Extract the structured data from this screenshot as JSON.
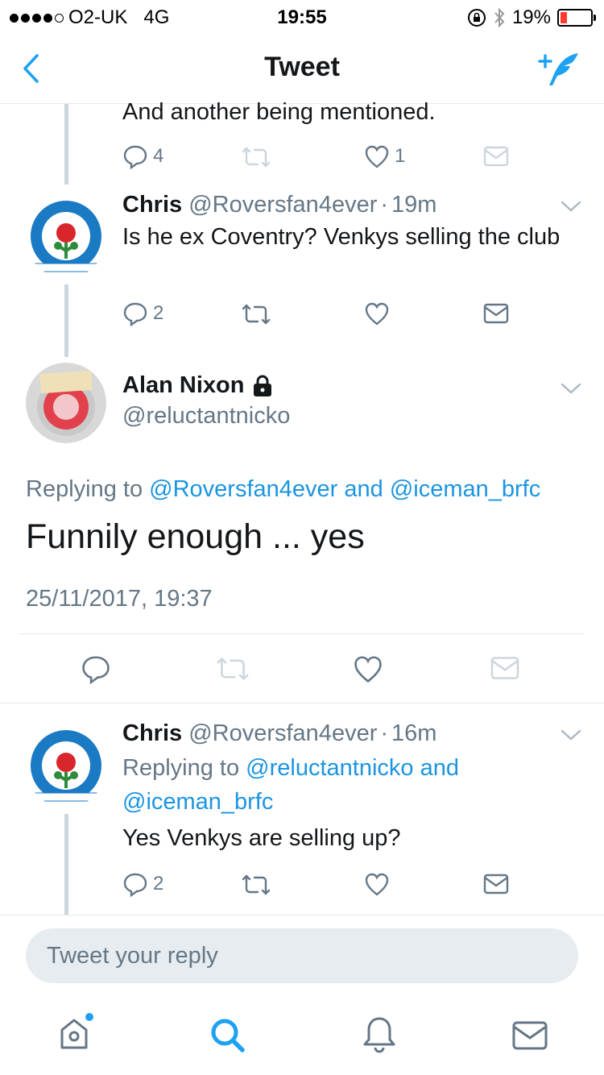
{
  "status": {
    "carrier": "O2-UK",
    "network": "4G",
    "time": "19:55",
    "battery": "19%"
  },
  "nav": {
    "title": "Tweet",
    "back_icon": "chevron-left-icon",
    "compose_icon": "compose-tweet-icon"
  },
  "prev_tweet": {
    "text_tail": "And another being mentioned.",
    "reply_count": "4",
    "like_count": "1"
  },
  "tweet1": {
    "name": "Chris",
    "handle": "@Roversfan4ever",
    "sep": "·",
    "time": "19m",
    "text": "Is he ex Coventry? Venkys selling the club",
    "reply_count": "2"
  },
  "main": {
    "name": "Alan Nixon",
    "handle": "@reluctantnicko",
    "replying_prefix": "Replying to",
    "reply_a": "@Roversfan4ever",
    "and": "and",
    "reply_b": "@iceman_brfc",
    "text": "Funnily enough ... yes",
    "datetime": "25/11/2017, 19:37"
  },
  "tweet2": {
    "name": "Chris",
    "handle": "@Roversfan4ever",
    "sep": "·",
    "time": "16m",
    "replying_prefix": "Replying to",
    "reply_a": "@reluctantnicko",
    "and": "and",
    "reply_b": "@iceman_brfc",
    "text": "Yes Venkys are selling up?",
    "reply_count": "2"
  },
  "reply_box": {
    "placeholder": "Tweet your reply"
  },
  "tabbar": {
    "items": [
      "home-icon",
      "search-icon",
      "notifications-icon",
      "messages-icon"
    ]
  },
  "colors": {
    "accent": "#1da1f2",
    "gray": "#657786",
    "divider": "#e1e8ed",
    "battery_low": "#ff3b30"
  }
}
